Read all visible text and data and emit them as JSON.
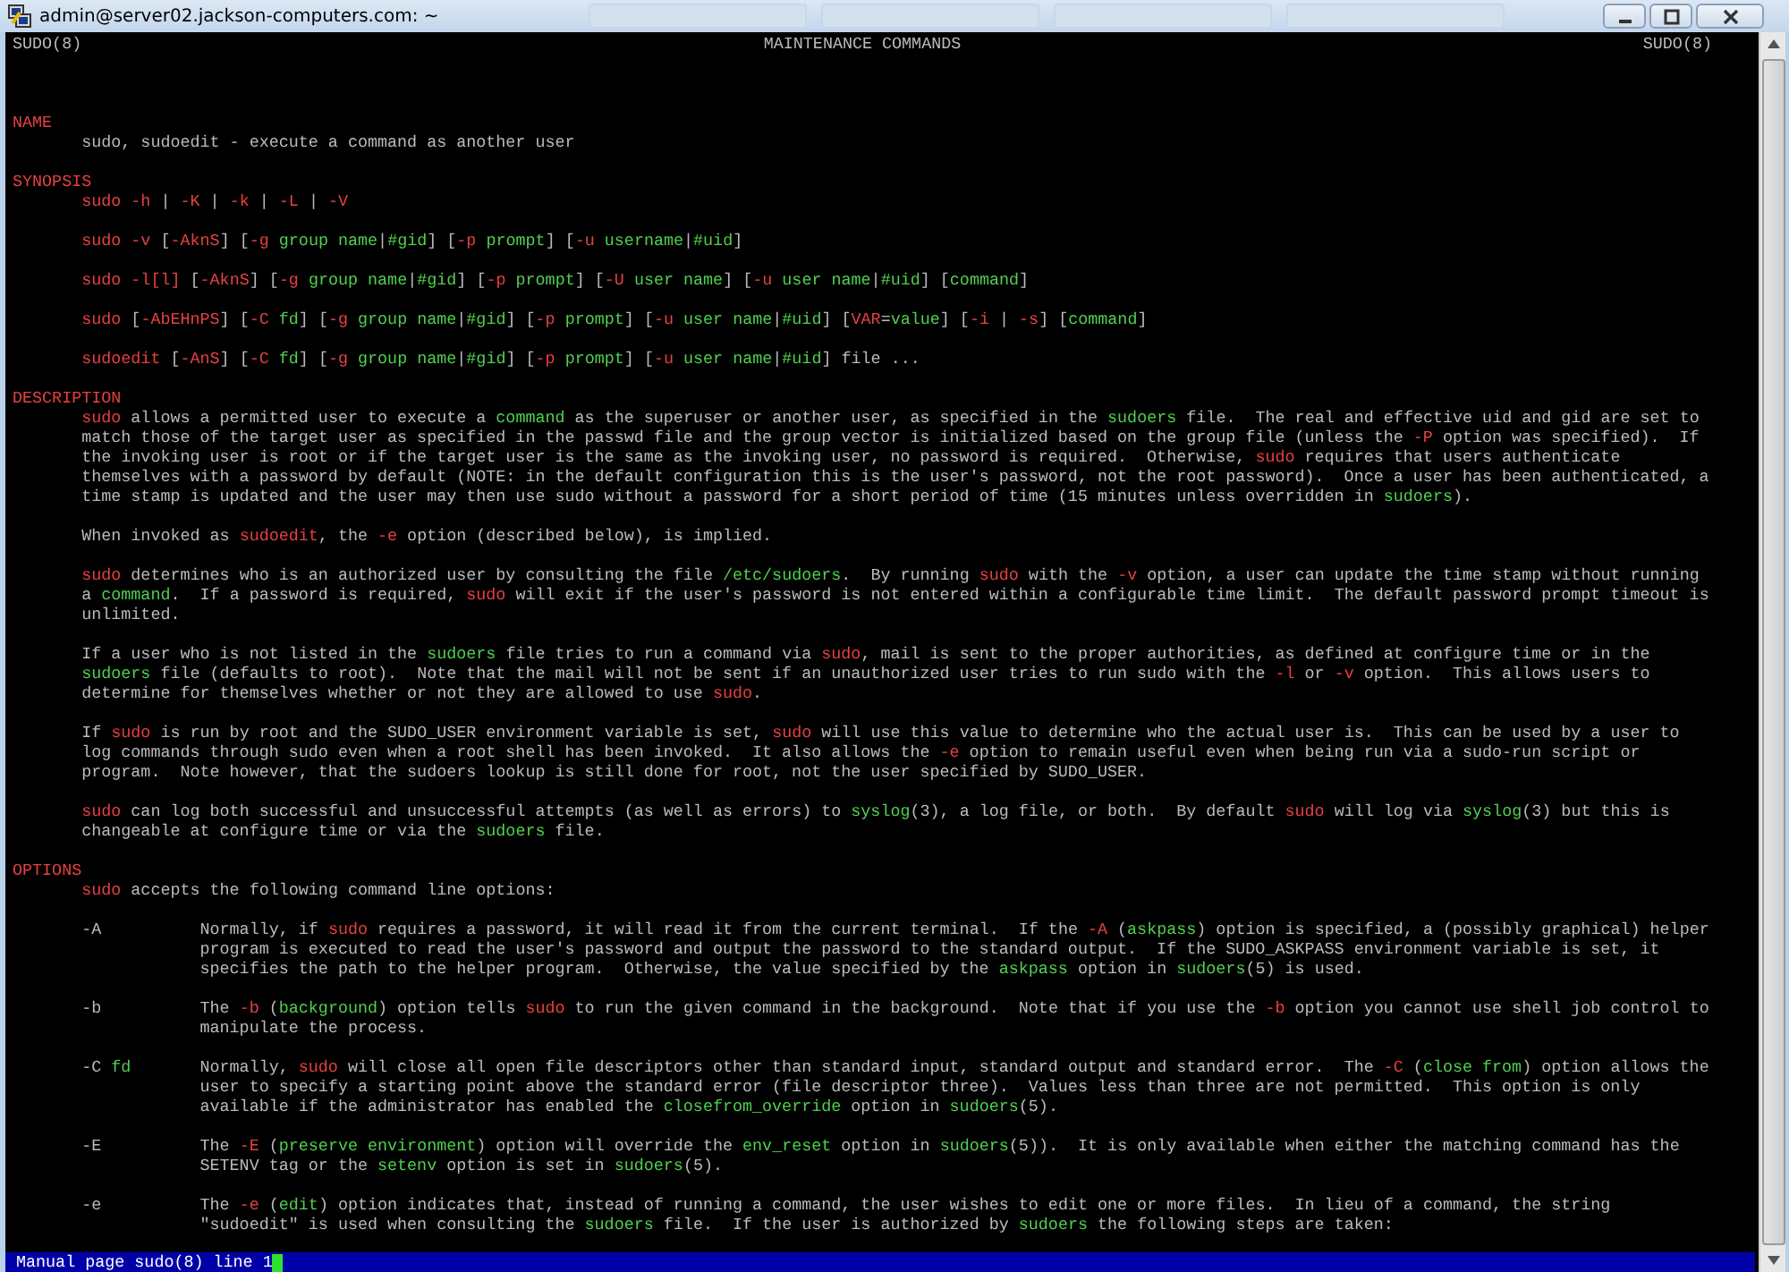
{
  "window": {
    "title": "admin@server02.jackson-computers.com: ~"
  },
  "man_header": {
    "left": "SUDO(8)",
    "center": "MAINTENANCE COMMANDS",
    "right": "SUDO(8)"
  },
  "sections": [
    {
      "heading": "NAME",
      "paragraphs": [
        [
          "sudo, sudoedit - execute a command as another user"
        ]
      ]
    },
    {
      "heading": "SYNOPSIS",
      "paragraphs": [
        [
          "**sudo** **-h** | **-K** | **-k** | **-L** | **-V**"
        ],
        [
          "**sudo** **-v** [**-AknS**] [**-g** *group name*|*#gid*] [**-p** *prompt*] [**-u** *username*|*#uid*]"
        ],
        [
          "**sudo** **-l[l]** [**-AknS**] [**-g** *group name*|*#gid*] [**-p** *prompt*] [**-U** *user name*] [**-u** *user name*|*#uid*] [*command*]"
        ],
        [
          "**sudo** [**-AbEHnPS**] [**-C** *fd*] [**-g** *group name*|*#gid*] [**-p** *prompt*] [**-u** *user name*|*#uid*] [**VAR**=*value*] [**-i** | **-s**] [*command*]"
        ],
        [
          "**sudoedit** [**-AnS**] [**-C** *fd*] [**-g** *group name*|*#gid*] [**-p** *prompt*] [**-u** *user name*|*#uid*] file ..."
        ]
      ]
    },
    {
      "heading": "DESCRIPTION",
      "paragraphs": [
        [
          "**sudo** allows a permitted user to execute a *command* as the superuser or another user, as specified in the *sudoers* file.  The real and effective uid and gid are set to",
          "match those of the target user as specified in the passwd file and the group vector is initialized based on the group file (unless the **-P** option was specified).  If",
          "the invoking user is root or if the target user is the same as the invoking user, no password is required.  Otherwise, **sudo** requires that users authenticate",
          "themselves with a password by default (NOTE: in the default configuration this is the user's password, not the root password).  Once a user has been authenticated, a",
          "time stamp is updated and the user may then use sudo without a password for a short period of time (15 minutes unless overridden in *sudoers*)."
        ],
        [
          "When invoked as **sudoedit**, the **-e** option (described below), is implied."
        ],
        [
          "**sudo** determines who is an authorized user by consulting the file */etc/sudoers*.  By running **sudo** with the **-v** option, a user can update the time stamp without running",
          "a *command*.  If a password is required, **sudo** will exit if the user's password is not entered within a configurable time limit.  The default password prompt timeout is",
          "unlimited."
        ],
        [
          "If a user who is not listed in the *sudoers* file tries to run a command via **sudo**, mail is sent to the proper authorities, as defined at configure time or in the",
          "*sudoers* file (defaults to root).  Note that the mail will not be sent if an unauthorized user tries to run sudo with the **-l** or **-v** option.  This allows users to",
          "determine for themselves whether or not they are allowed to use **sudo**."
        ],
        [
          "If **sudo** is run by root and the SUDO_USER environment variable is set, **sudo** will use this value to determine who the actual user is.  This can be used by a user to",
          "log commands through sudo even when a root shell has been invoked.  It also allows the **-e** option to remain useful even when being run via a sudo-run script or",
          "program.  Note however, that the sudoers lookup is still done for root, not the user specified by SUDO_USER."
        ],
        [
          "**sudo** can log both successful and unsuccessful attempts (as well as errors) to *syslog*(3), a log file, or both.  By default **sudo** will log via *syslog*(3) but this is",
          "changeable at configure time or via the *sudoers* file."
        ]
      ]
    },
    {
      "heading": "OPTIONS",
      "paragraphs": [
        [
          "**sudo** accepts the following command line options:"
        ]
      ],
      "options": [
        {
          "flag": "-A",
          "lines": [
            "Normally, if **sudo** requires a password, it will read it from the current terminal.  If the **-A** (*askpass*) option is specified, a (possibly graphical) helper",
            "program is executed to read the user's password and output the password to the standard output.  If the SUDO_ASKPASS environment variable is set, it",
            "specifies the path to the helper program.  Otherwise, the value specified by the *askpass* option in *sudoers*(5) is used."
          ]
        },
        {
          "flag": "-b",
          "lines": [
            "The **-b** (*background*) option tells **sudo** to run the given command in the background.  Note that if you use the **-b** option you cannot use shell job control to",
            "manipulate the process."
          ]
        },
        {
          "flag": "-C *fd*",
          "lines": [
            "Normally, **sudo** will close all open file descriptors other than standard input, standard output and standard error.  The **-C** (*close from*) option allows the",
            "user to specify a starting point above the standard error (file descriptor three).  Values less than three are not permitted.  This option is only",
            "available if the administrator has enabled the *closefrom_override* option in *sudoers*(5)."
          ]
        },
        {
          "flag": "-E",
          "lines": [
            "The **-E** (*preserve environment*) option will override the *env_reset* option in *sudoers*(5)).  It is only available when either the matching command has the",
            "SETENV tag or the *setenv* option is set in *sudoers*(5)."
          ]
        },
        {
          "flag": "-e",
          "lines": [
            "The **-e** (*edit*) option indicates that, instead of running a command, the user wishes to edit one or more files.  In lieu of a command, the string",
            "\"sudoedit\" is used when consulting the *sudoers* file.  If the user is authorized by *sudoers* the following steps are taken:"
          ]
        }
      ]
    }
  ],
  "status_line": "Manual page sudo(8) line 1"
}
